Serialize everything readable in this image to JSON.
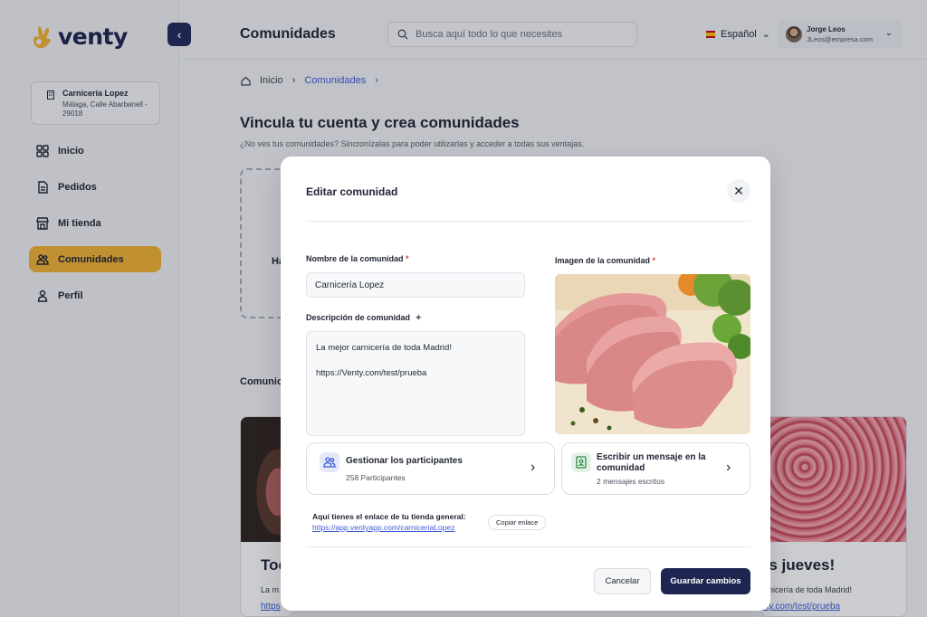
{
  "app": {
    "brand": "venty",
    "accent": "#f2b434",
    "primary": "#1e2550"
  },
  "sidebar": {
    "store": {
      "name": "Carnicería Lopez",
      "address": "Málaga, Calle Abarbanell - 29018"
    },
    "items": [
      {
        "label": "Inicio",
        "icon": "grid-icon"
      },
      {
        "label": "Pedidos",
        "icon": "document-icon"
      },
      {
        "label": "Mi tienda",
        "icon": "store-icon"
      },
      {
        "label": "Comunidades",
        "icon": "users-icon",
        "active": true
      },
      {
        "label": "Perfil",
        "icon": "user-icon"
      }
    ]
  },
  "header": {
    "title": "Comunidades",
    "search_placeholder": "Busca aquí todo lo que necesites",
    "language": "Español",
    "user": {
      "name": "Jorge Leos",
      "email": "JLeos@empresa.com"
    }
  },
  "breadcrumb": {
    "home": "Inicio",
    "current": "Comunidades"
  },
  "main": {
    "heading": "Vincula tu cuenta y crea comunidades",
    "subheading": "¿No ves tus comunidades? Sincronízalas para poder utilizarlas y acceder a todas sus ventajas.",
    "dashed_text": "Ha",
    "communities_label": "Comunic",
    "card1": {
      "title": "Toc",
      "desc": "La m",
      "link": "https"
    },
    "card3": {
      "title": "os jueves!",
      "desc": "rnicería de toda Madrid!",
      "link": "nty.com/test/prueba"
    }
  },
  "modal": {
    "title": "Editar comunidad",
    "name_label": "Nombre de la comunidad",
    "name_value": "Carnicería Lopez",
    "desc_label": "Descripción de comunidad",
    "desc_line1": "La mejor carnicería de toda Madrid!",
    "desc_line2": "https://Venty.com/test/prueba",
    "image_label": "Imagen de la comunidad",
    "required_mark": "*",
    "participants": {
      "title": "Gestionar los participantes",
      "subtitle": "258 Participantes"
    },
    "message": {
      "title_line1": "Escribir un mensaje en la",
      "title_line2": "comunidad",
      "subtitle": "2 mensajes escritos"
    },
    "link_label": "Aquí tienes el enlace de tu tienda general:",
    "link_url": "https://app.ventyapp.com/carniceriaLopez",
    "copy_label": "Copiar enlace",
    "cancel_label": "Cancelar",
    "save_label": "Guardar cambios"
  }
}
